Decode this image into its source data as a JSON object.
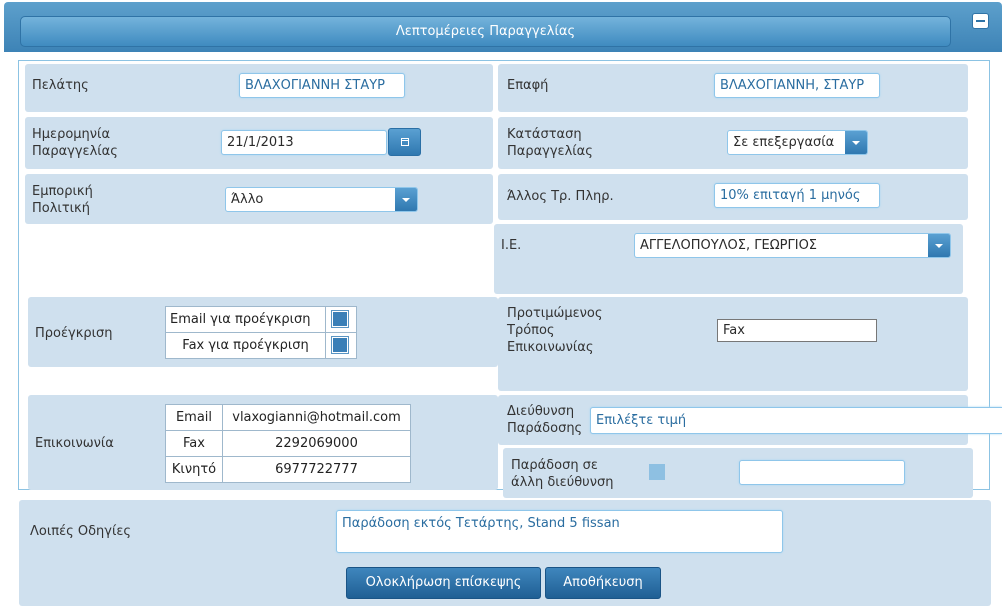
{
  "header": {
    "title": "Λεπτομέρειες Παραγγελίας"
  },
  "customer": {
    "label": "Πελάτης",
    "value": "ΒΛΑΧΟΓΙΑΝΝΗ ΣΤΑΥΡ"
  },
  "contact": {
    "label": "Επαφή",
    "value": "ΒΛΑΧΟΓΙΑΝΝΗ, ΣΤΑΥΡ"
  },
  "order_date": {
    "label_line1": "Ημερομηνία",
    "label_line2": "Παραγγελίας",
    "value": "21/1/2013"
  },
  "order_status": {
    "label_line1": "Κατάσταση",
    "label_line2": "Παραγγελίας",
    "value": "Σε επεξεργασία"
  },
  "commercial_policy": {
    "label_line1": "Εμπορική",
    "label_line2": "Πολιτική",
    "value": "Άλλο"
  },
  "payment": {
    "label": "Άλλος Τρ. Πληρ.",
    "value": "10% επιταγή 1 μηνός"
  },
  "rep": {
    "label": "Ι.Ε.",
    "value": "ΑΓΓΕΛΟΠΟΥΛΟΣ, ΓΕΩΡΓΙΟΣ"
  },
  "preapproval": {
    "label": "Προέγκριση",
    "options": [
      {
        "label": "Email για προέγκριση"
      },
      {
        "label": "Fax για προέγκριση"
      }
    ]
  },
  "preferred_contact": {
    "label_line1": "Προτιμώμενος",
    "label_line2": "Τρόπος",
    "label_line3": "Επικοινωνίας",
    "value": "Fax"
  },
  "communication": {
    "label": "Επικοινωνία",
    "rows": [
      {
        "type": "Email",
        "value": "vlaxogianni@hotmail.com"
      },
      {
        "type": "Fax",
        "value": "2292069000"
      },
      {
        "type": "Κινητό",
        "value": "6977722777"
      }
    ]
  },
  "delivery_address": {
    "label_line1": "Διεύθυνση",
    "label_line2": "Παράδοσης",
    "placeholder": "Επιλέξτε τιμή"
  },
  "other_address": {
    "label_line1": "Παράδοση σε",
    "label_line2": "άλλη διεύθυνση",
    "value": ""
  },
  "notes": {
    "label": "Λοιπές Οδηγίες",
    "value": "Παράδοση εκτός Τετάρτης, Stand 5 fissan"
  },
  "buttons": {
    "complete_visit": "Ολοκλήρωση επίσκεψης",
    "save": "Αποθήκευση"
  }
}
